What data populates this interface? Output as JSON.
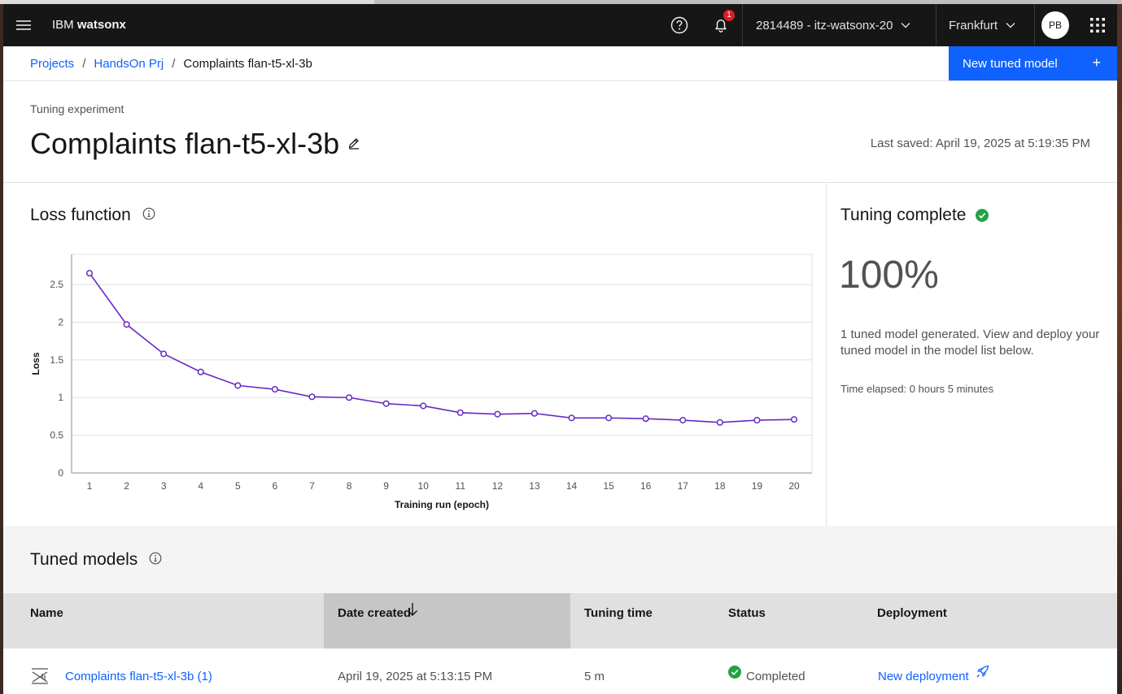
{
  "header": {
    "brand_prefix": "IBM",
    "brand_name": "watsonx",
    "notification_count": "1",
    "account": "2814489 - itz-watsonx-20",
    "region": "Frankfurt",
    "avatar_initials": "PB"
  },
  "breadcrumb": {
    "items": [
      "Projects",
      "HandsOn Prj"
    ],
    "current": "Complaints flan-t5-xl-3b"
  },
  "actions": {
    "new_tuned_model": "New tuned model",
    "plus": "+"
  },
  "page": {
    "kicker": "Tuning experiment",
    "title": "Complaints flan-t5-xl-3b",
    "last_saved": "Last saved: April 19, 2025 at 5:19:35 PM"
  },
  "loss_panel": {
    "title": "Loss function"
  },
  "chart_data": {
    "type": "line",
    "title": "",
    "xlabel": "Training run (epoch)",
    "ylabel": "Loss",
    "x": [
      1,
      2,
      3,
      4,
      5,
      6,
      7,
      8,
      9,
      10,
      11,
      12,
      13,
      14,
      15,
      16,
      17,
      18,
      19,
      20
    ],
    "series": [
      {
        "values": [
          2.65,
          1.97,
          1.58,
          1.34,
          1.16,
          1.11,
          1.01,
          1.0,
          0.92,
          0.89,
          0.8,
          0.78,
          0.79,
          0.73,
          0.73,
          0.72,
          0.7,
          0.67,
          0.7,
          0.71
        ]
      }
    ],
    "yticks": [
      "0",
      "0.5",
      "1",
      "1.5",
      "2",
      "2.5"
    ],
    "ylim": [
      0,
      2.9
    ],
    "grid": true,
    "color": "#6929c4"
  },
  "tuning_status": {
    "title": "Tuning complete",
    "percent": "100%",
    "message": "1 tuned model generated. View and deploy your tuned model in the model list below.",
    "elapsed": "Time elapsed: 0 hours 5 minutes"
  },
  "tuned_models": {
    "title": "Tuned models",
    "columns": [
      "Name",
      "Date created",
      "Tuning time",
      "Status",
      "Deployment"
    ],
    "sorted_column": "Date created",
    "rows": [
      {
        "name": "Complaints flan-t5-xl-3b (1)",
        "date_created": "April 19, 2025 at 5:13:15 PM",
        "tuning_time": "5 m",
        "status": "Completed",
        "deployment": "New deployment"
      }
    ]
  },
  "colors": {
    "header_bg": "#161616",
    "primary": "#0f62fe",
    "success": "#24a148",
    "badge": "#da1e28",
    "series": "#6929c4"
  }
}
